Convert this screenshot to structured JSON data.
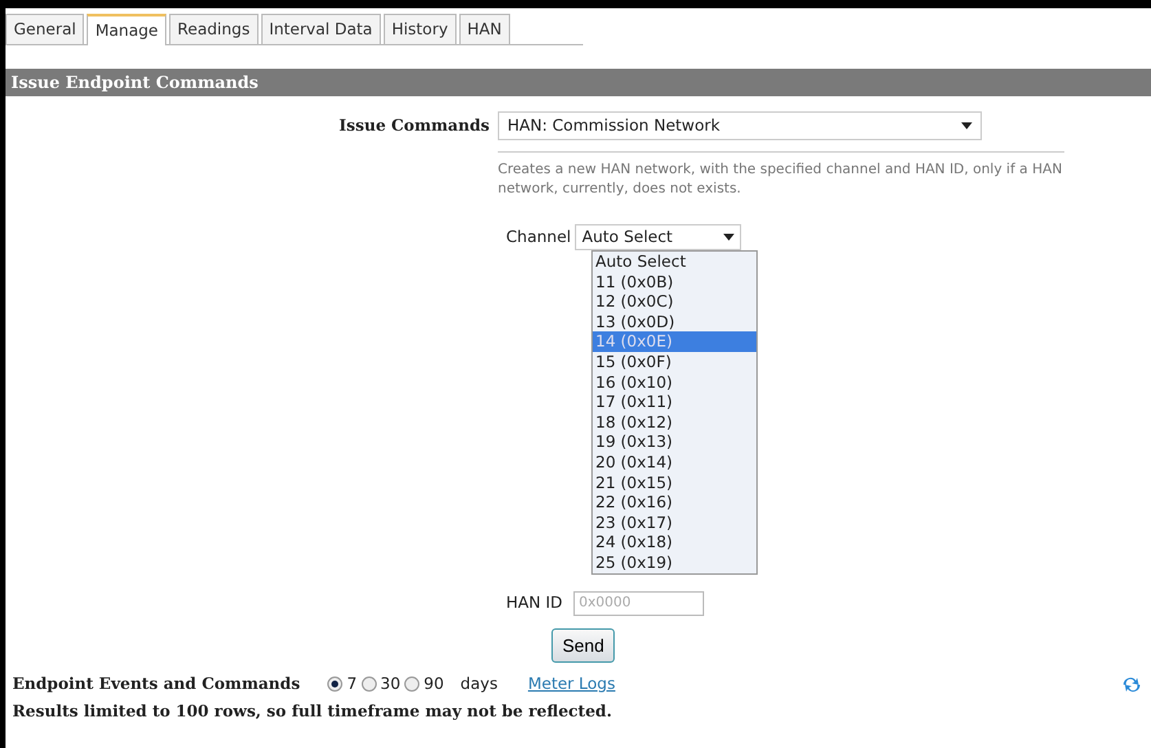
{
  "tabs": [
    {
      "label": "General",
      "selected": false
    },
    {
      "label": "Manage",
      "selected": true
    },
    {
      "label": "Readings",
      "selected": false
    },
    {
      "label": "Interval Data",
      "selected": false
    },
    {
      "label": "History",
      "selected": false
    },
    {
      "label": "HAN",
      "selected": false
    }
  ],
  "section_title": "Issue Endpoint Commands",
  "issue_commands": {
    "label": "Issue Commands",
    "value": "HAN: Commission Network",
    "description": "Creates a new HAN network, with the specified channel and HAN ID, only if a HAN network, currently, does not exists."
  },
  "channel": {
    "label": "Channel",
    "value": "Auto Select",
    "options": [
      {
        "label": "Auto Select",
        "highlighted": false
      },
      {
        "label": "11 (0x0B)",
        "highlighted": false
      },
      {
        "label": "12 (0x0C)",
        "highlighted": false
      },
      {
        "label": "13 (0x0D)",
        "highlighted": false
      },
      {
        "label": "14 (0x0E)",
        "highlighted": true
      },
      {
        "label": "15 (0x0F)",
        "highlighted": false
      },
      {
        "label": "16 (0x10)",
        "highlighted": false
      },
      {
        "label": "17 (0x11)",
        "highlighted": false
      },
      {
        "label": "18 (0x12)",
        "highlighted": false
      },
      {
        "label": "19 (0x13)",
        "highlighted": false
      },
      {
        "label": "20 (0x14)",
        "highlighted": false
      },
      {
        "label": "21 (0x15)",
        "highlighted": false
      },
      {
        "label": "22 (0x16)",
        "highlighted": false
      },
      {
        "label": "23 (0x17)",
        "highlighted": false
      },
      {
        "label": "24 (0x18)",
        "highlighted": false
      },
      {
        "label": "25 (0x19)",
        "highlighted": false
      }
    ]
  },
  "han_id": {
    "label": "HAN ID",
    "placeholder": "0x0000"
  },
  "send_button": "Send",
  "events": {
    "label": "Endpoint Events and Commands",
    "ranges": [
      {
        "label": "7",
        "selected": true
      },
      {
        "label": "30",
        "selected": false
      },
      {
        "label": "90",
        "selected": false
      }
    ],
    "unit": "days",
    "link": "Meter Logs"
  },
  "notice": "Results limited to 100 rows, so full timeframe may not be reflected."
}
